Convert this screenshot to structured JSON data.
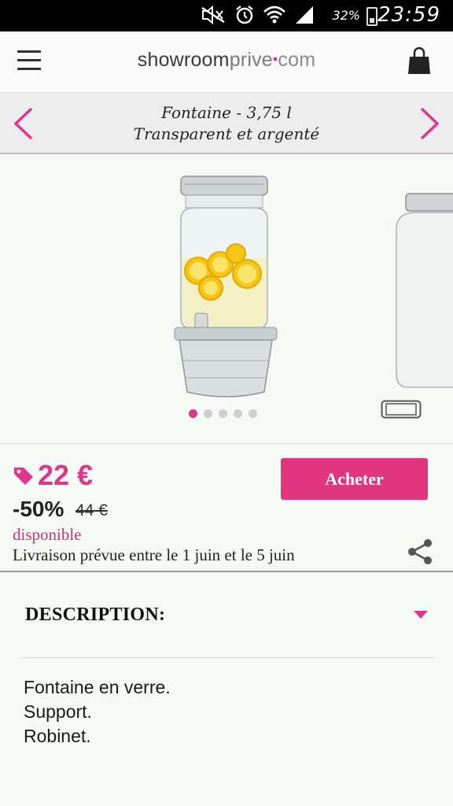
{
  "status_bar": {
    "battery": "32%",
    "time": "23:59"
  },
  "header": {
    "logo_part1": "showroom",
    "logo_part2": "prive",
    "logo_dot": "•",
    "logo_part3": "com",
    "menu_icon": "hamburger-menu-icon",
    "cart_icon": "shopping-bag-icon"
  },
  "product_nav": {
    "title_line1": "Fontaine - 3,75 l",
    "title_line2": "Transparent et argenté",
    "prev_icon": "chevron-left-icon",
    "next_icon": "chevron-right-icon",
    "accent": "#e0358a"
  },
  "carousel": {
    "image_count": 5,
    "active_index": 0
  },
  "pricing": {
    "price": "22 €",
    "discount": "-50%",
    "old_price": "44 €",
    "availability": "disponible",
    "delivery": "Livraison prévue entre le 1 juin et le 5 juin",
    "buy_label": "Acheter",
    "buy_color": "#e0357f"
  },
  "description": {
    "title": "DESCRIPTION:",
    "lines": [
      "Fontaine en verre.",
      "Support.",
      "Robinet."
    ]
  }
}
